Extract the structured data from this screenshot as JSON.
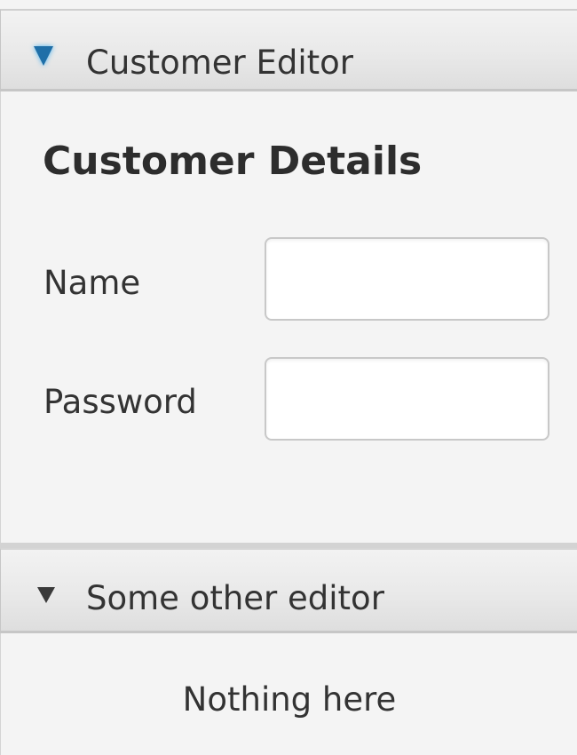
{
  "panes": [
    {
      "title": "Customer Editor",
      "expanded": true,
      "arrow_icon": "expanded-arrow-icon",
      "arrow_color": "#1f6fa8",
      "content": {
        "heading": "Customer Details",
        "fields": [
          {
            "label": "Name",
            "value": "",
            "placeholder": ""
          },
          {
            "label": "Password",
            "value": "",
            "placeholder": ""
          }
        ]
      }
    },
    {
      "title": "Some other editor",
      "expanded": true,
      "arrow_icon": "expanded-arrow-icon",
      "arrow_color": "#3a3a3a",
      "content": {
        "text": "Nothing here"
      }
    }
  ]
}
